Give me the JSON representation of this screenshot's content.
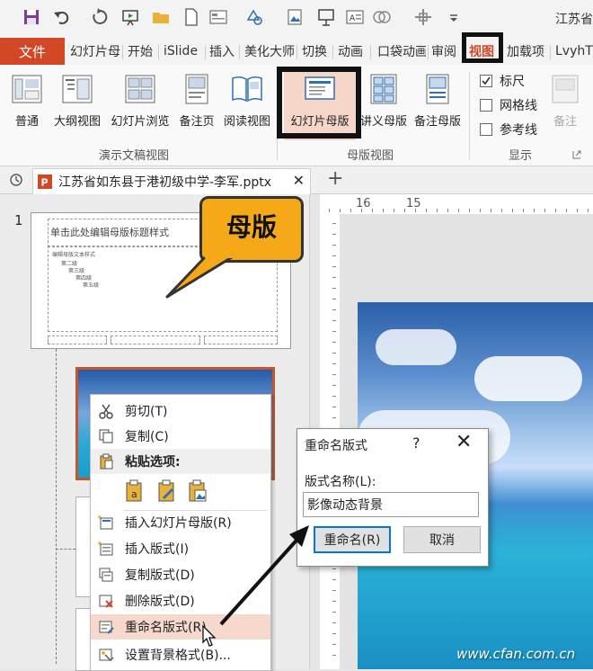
{
  "window": {
    "title": "江苏省"
  },
  "tabs": {
    "file": "文件",
    "items": [
      "幻灯片母",
      "开始",
      "iSlide",
      "插入",
      "美化大师",
      "切换",
      "动画",
      "口袋动画",
      "审阅",
      "视图",
      "加载项",
      "LvyhT"
    ]
  },
  "ribbon": {
    "buttons": [
      "普通",
      "大纲视图",
      "幻灯片浏览",
      "备注页",
      "阅读视图",
      "幻灯片母版",
      "讲义母版",
      "备注母版"
    ],
    "checks": [
      "标尺",
      "网格线",
      "参考线"
    ],
    "extra": "备注",
    "groups": [
      "演示文稿视图",
      "母版视图",
      "显示"
    ]
  },
  "doc": {
    "tab_name": "江苏省如东县于港初级中学-李军.pptx"
  },
  "slides": {
    "number": "1",
    "master_title": "单击此处编辑母版标题样式",
    "master_body": [
      "编辑母版文本样式",
      "第二级",
      "第三级",
      "第四级",
      "第五级"
    ]
  },
  "callout": {
    "text": "母版"
  },
  "context_menu": {
    "items": [
      "剪切(T)",
      "复制(C)",
      "粘贴选项:",
      "插入幻灯片母版(R)",
      "插入版式(I)",
      "复制版式(D)",
      "删除版式(D)",
      "重命名版式(R)",
      "设置背景格式(B)..."
    ]
  },
  "dialog": {
    "title": "重命名版式",
    "help": "?",
    "close": "✕",
    "label": "版式名称(L):",
    "value": "影像动态背景",
    "ok": "重命名(R)",
    "cancel": "取消"
  },
  "ruler": {
    "top": "16",
    "top2": "15"
  },
  "watermark": "www.cfan.com.cn",
  "colors": {
    "file_tab": "#d24726",
    "callout": "#f5a918",
    "highlight": "#111111",
    "selected_border": "#c5562b"
  }
}
